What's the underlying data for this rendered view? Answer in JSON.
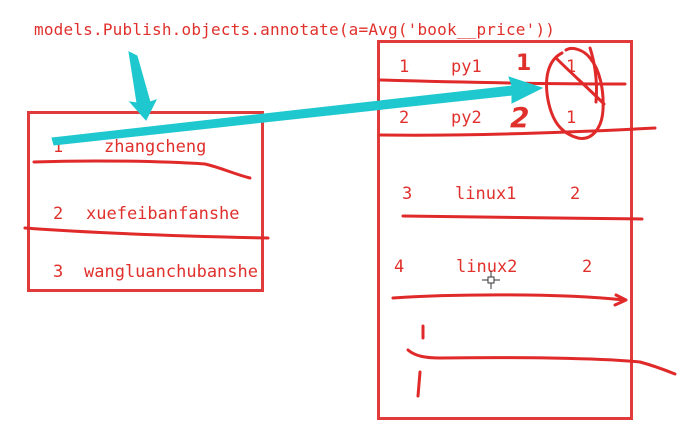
{
  "code_line": "models.Publish.objects.annotate(a=Avg('book__price'))",
  "publish_table": {
    "rows": [
      {
        "id": "1",
        "name": "zhangcheng"
      },
      {
        "id": "2",
        "name": "xuefeibanfanshe"
      },
      {
        "id": "3",
        "name": "wangluanchubanshe"
      }
    ]
  },
  "book_table": {
    "rows": [
      {
        "id": "1",
        "title": "py1",
        "publish_id": "1"
      },
      {
        "id": "2",
        "title": "py2",
        "publish_id": "1"
      },
      {
        "id": "3",
        "title": "linux1",
        "publish_id": "2"
      },
      {
        "id": "4",
        "title": "linux2",
        "publish_id": "2"
      }
    ]
  },
  "annotations": {
    "mark_1": "1",
    "mark_2": "2"
  },
  "colors": {
    "ink_red": "#e0302c",
    "arrow_cyan": "#1fc8cf"
  }
}
